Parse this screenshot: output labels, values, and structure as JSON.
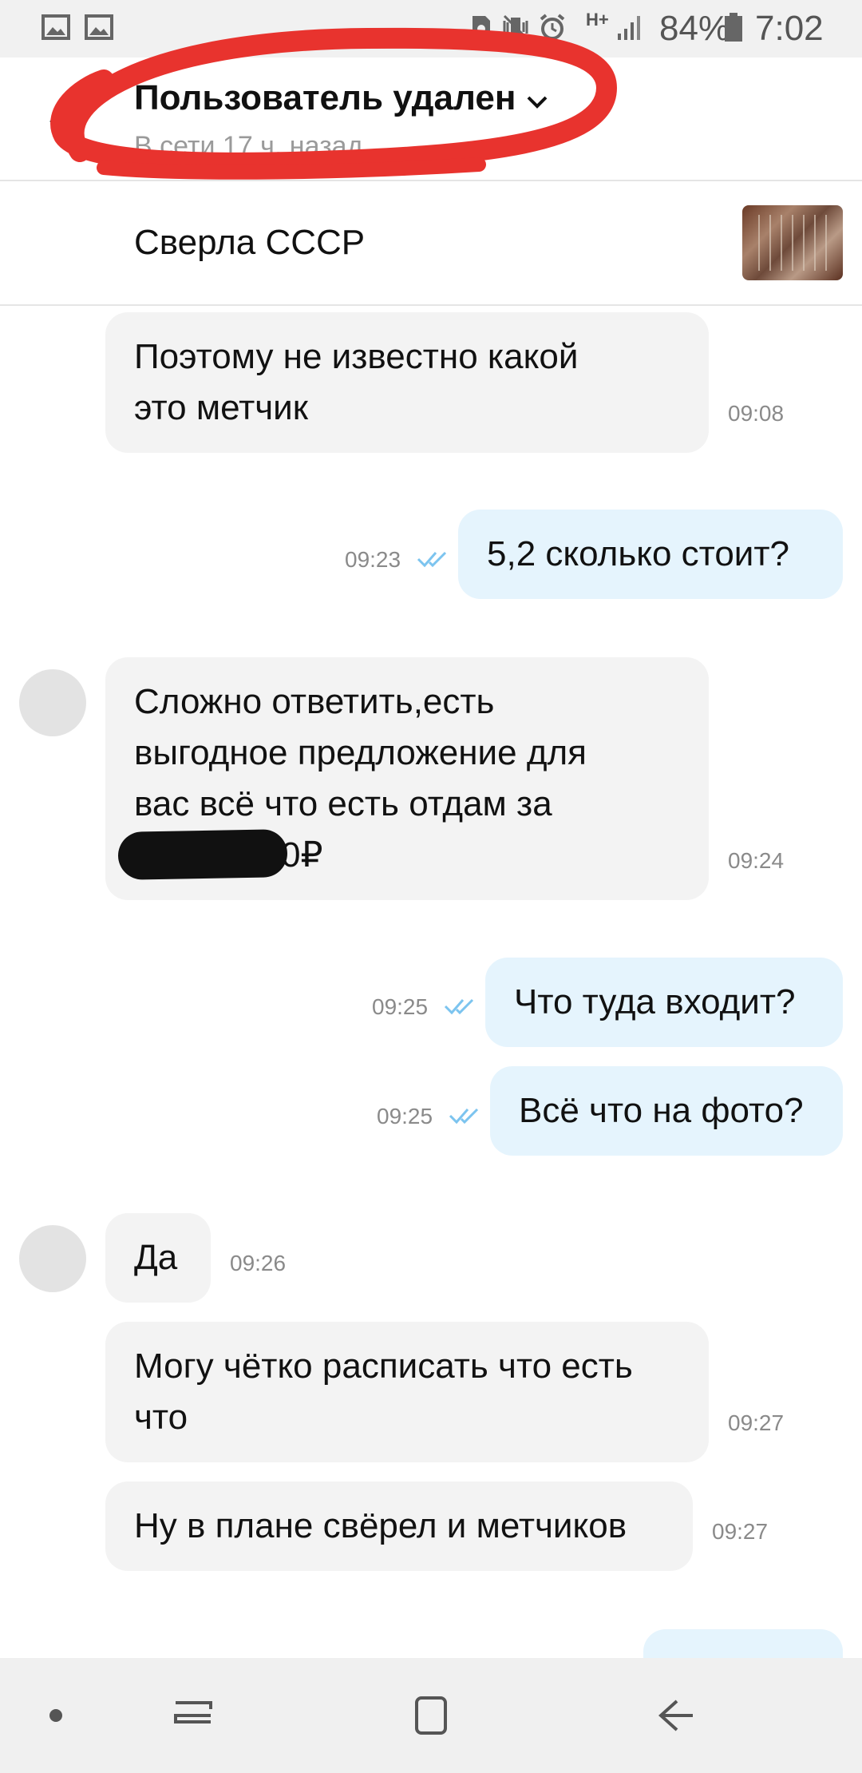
{
  "status_bar": {
    "battery_percent": "84%",
    "time": "7:02",
    "network": "H+"
  },
  "header": {
    "title": "Пользователь удален",
    "subtitle": "В сети 17 ч. назад"
  },
  "listing": {
    "title": "Сверла СССР"
  },
  "messages": [
    {
      "text_line1": "Поэтому не известно какой",
      "text_line2": "это метчик",
      "time": "09:08"
    },
    {
      "text": "5,2 сколько стоит?",
      "time": "09:23"
    },
    {
      "text_line1": "Сложно ответить,есть",
      "text_line2": "выгодное предложение для",
      "text_line3": "вас всё что есть отдам за",
      "text_line4": "0₽",
      "time": "09:24"
    },
    {
      "text": "Что туда входит?",
      "time": "09:25"
    },
    {
      "text": "Всё что на фото?",
      "time": "09:25"
    },
    {
      "text": "Да",
      "time": "09:26"
    },
    {
      "text_line1": "Могу чётко расписать что есть",
      "text_line2": "что",
      "time": "09:27"
    },
    {
      "text": "Ну в плане свёрел и метчиков",
      "time": "09:27"
    }
  ],
  "colors": {
    "incoming_bubble": "#f3f3f3",
    "outgoing_bubble": "#e5f4fd",
    "read_ticks": "#7cc4ef",
    "annotation_red": "#e8332e"
  }
}
